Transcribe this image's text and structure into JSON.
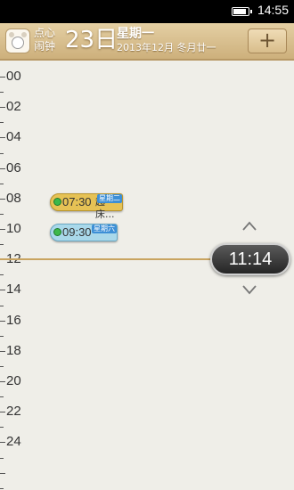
{
  "status_bar": {
    "time": "14:55",
    "battery_level": 0.9
  },
  "header": {
    "app_name_line1": "点心",
    "app_name_line2": "闹钟",
    "day": "23日",
    "weekday": "星期一",
    "date_subtitle": "2013年12月 冬月廿一",
    "add_button_label": "+"
  },
  "timeline": {
    "hour_labels": [
      "00",
      "02",
      "04",
      "06",
      "08",
      "10",
      "12",
      "14",
      "16",
      "18",
      "20",
      "22",
      "24"
    ],
    "current_time": "11:14"
  },
  "alarms": [
    {
      "time": "07:30",
      "label": "起床...",
      "tag": "星期二",
      "color": "#e6c255"
    },
    {
      "time": "09:30",
      "label": "",
      "tag": "星期六",
      "color": "#a9d8ea"
    }
  ]
}
